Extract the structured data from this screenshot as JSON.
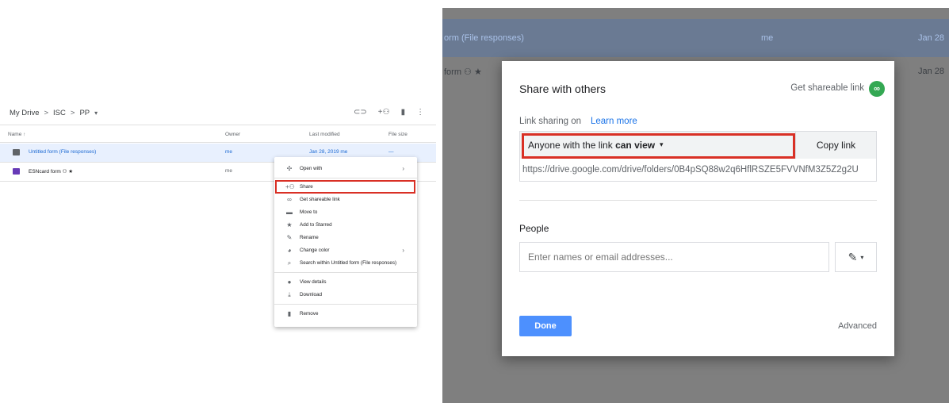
{
  "left_panel": {
    "breadcrumb": {
      "root": "My Drive",
      "sep": ">",
      "level1": "ISC",
      "level2": "PP",
      "caret": "▾"
    },
    "toolbar_icons": [
      "link-icon",
      "add-person-icon",
      "trash-icon",
      "more-vert-icon"
    ],
    "columns": {
      "name": "Name ↑",
      "owner": "Owner",
      "modified": "Last modified",
      "size": "File size"
    },
    "files": [
      {
        "name": "Untitled form (File responses)",
        "owner": "me",
        "modified": "Jan 28, 2019 me",
        "size": "—",
        "icon": "folder-icon",
        "color": "#5f6368",
        "selected": true
      },
      {
        "name": "ESNcard form  ⚇ ★",
        "owner": "me",
        "modified": "",
        "size": "",
        "icon": "form-icon",
        "color": "#673ab7",
        "selected": false
      }
    ],
    "context_menu": {
      "open_with": "Open with",
      "share": "Share",
      "get_link": "Get shareable link",
      "move_to": "Move to",
      "add_starred": "Add to Starred",
      "rename": "Rename",
      "change_color": "Change color",
      "search_within": "Search within Untitled form (File responses)",
      "view_details": "View details",
      "download": "Download",
      "remove": "Remove",
      "arrow": "›"
    }
  },
  "background_rows": {
    "row1_name": "orm (File responses)",
    "row1_owner": "me",
    "row1_date": "Jan 28",
    "row2_name": "form ⚇ ★",
    "row2_date": "Jan 28"
  },
  "dialog": {
    "title": "Share with others",
    "get_shareable_link": "Get shareable link",
    "link_sharing_on": "Link sharing on",
    "learn_more": "Learn more",
    "access_prefix": "Anyone with the link ",
    "access_level": "can view",
    "access_caret": "▾",
    "copy_link": "Copy link",
    "url": "https://drive.google.com/drive/folders/0B4pSQ88w2q6HflRSZE5FVVNfM3Z5Z2g2U",
    "people_label": "People",
    "people_placeholder": "Enter names or email addresses...",
    "done": "Done",
    "advanced": "Advanced"
  },
  "colors": {
    "accent": "#1a73e8",
    "highlight": "#d93025",
    "done_button": "#4d90fe",
    "link_badge": "#34a853"
  }
}
